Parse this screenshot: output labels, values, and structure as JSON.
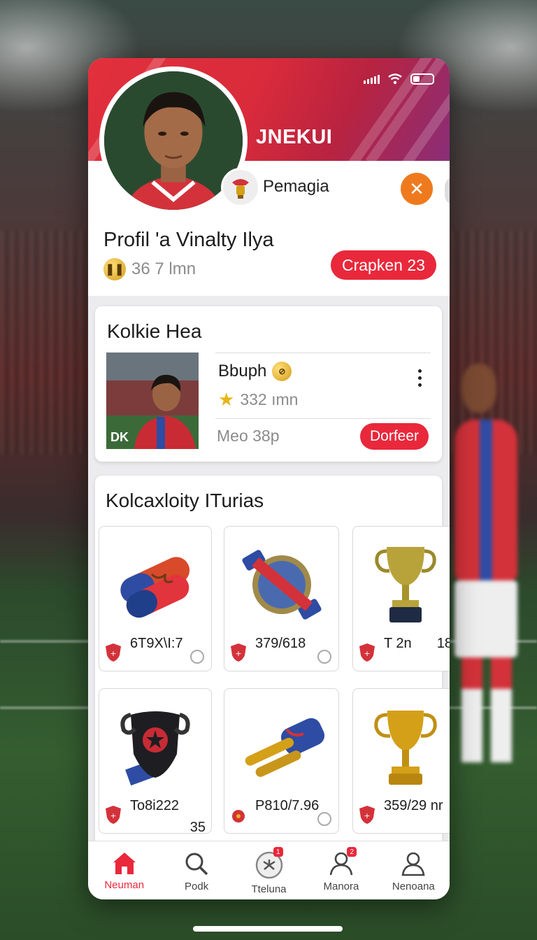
{
  "status_bar": {
    "signal": "signal-icon",
    "wifi": "wifi-icon",
    "battery": "battery-icon"
  },
  "header": {
    "brand": "JNEKUI"
  },
  "profile": {
    "club_name": "Pemagia",
    "title": "Profil 'a Vinalty Ilya",
    "stat": "36 7 lmn",
    "action_label": "Crapken 23"
  },
  "featured": {
    "title": "Kolkie Hea",
    "thumb_tag": "DK",
    "name": "Bbuph",
    "rating": "332 ımn",
    "subtitle": "Meo 38p",
    "button_label": "Dorfeer"
  },
  "collection": {
    "title": "Kolcaxloity ITurias",
    "items": [
      {
        "label": "6T9X\\I:7",
        "extra": "",
        "icon": "gloves-icon"
      },
      {
        "label": "379/618",
        "extra": "",
        "icon": "badge-icon"
      },
      {
        "label": "T 2n",
        "extra": "18",
        "icon": "trophy-icon"
      },
      {
        "label": "To8i222",
        "extra": "35",
        "icon": "crest-icon"
      },
      {
        "label": "P810/7.96",
        "extra": "",
        "icon": "boots-icon"
      },
      {
        "label": "359/29 nr",
        "extra": "",
        "icon": "trophy-icon"
      }
    ]
  },
  "nav": [
    {
      "label": "Neuman",
      "icon": "home-icon",
      "badge": ""
    },
    {
      "label": "Podk",
      "icon": "search-icon",
      "badge": ""
    },
    {
      "label": "Tteluna",
      "icon": "ball-icon",
      "badge": "1"
    },
    {
      "label": "Manora",
      "icon": "people-icon",
      "badge": "2"
    },
    {
      "label": "Nenoana",
      "icon": "profile-icon",
      "badge": ""
    }
  ],
  "colors": {
    "accent": "#e9283b",
    "orange": "#ef7a1e",
    "gold": "#d4a018"
  }
}
